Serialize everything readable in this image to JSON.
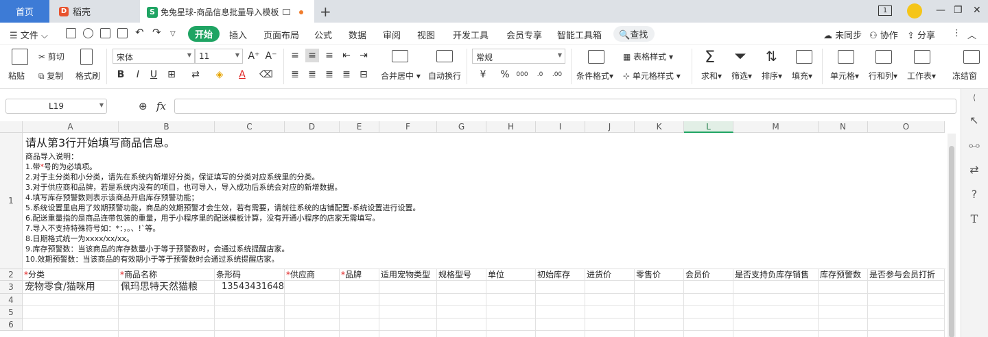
{
  "tabs": {
    "home": "首页",
    "docer": "稻壳",
    "file_title": "免兔星球-商品信息批量导入模板",
    "add": "+"
  },
  "window": {
    "page_indicator": "1",
    "minimize": "—",
    "restore": "❐",
    "close": "✕"
  },
  "menu": {
    "file": "文件",
    "items": [
      "开始",
      "插入",
      "页面布局",
      "公式",
      "数据",
      "审阅",
      "视图",
      "开发工具",
      "会员专享",
      "智能工具箱"
    ],
    "search": "查找",
    "right": [
      "未同步",
      "协作",
      "分享"
    ]
  },
  "ribbon": {
    "paste": "粘贴",
    "cut": "剪切",
    "copy": "复制",
    "format_painter": "格式刷",
    "font_name": "宋体",
    "font_size": "11",
    "merge_center": "合并居中",
    "wrap_text": "自动换行",
    "number_format": "常规",
    "conditional_format": "条件格式",
    "table_style": "表格样式",
    "cell_style": "单元格样式",
    "sum": "求和",
    "filter": "筛选",
    "sort": "排序",
    "fill": "填充",
    "cell": "单元格",
    "row_col": "行和列",
    "worksheet": "工作表",
    "freeze": "冻结窗"
  },
  "formula_bar": {
    "name_box": "L19",
    "fx": "fx",
    "value": ""
  },
  "columns": [
    "A",
    "B",
    "C",
    "D",
    "E",
    "F",
    "G",
    "H",
    "I",
    "J",
    "K",
    "L",
    "M",
    "N",
    "O"
  ],
  "selected_column": "L",
  "rows": [
    "1",
    "2",
    "3",
    "4",
    "5",
    "6"
  ],
  "instructions": {
    "title": "请从第3行开始填写商品信息。",
    "subtitle": "商品导入说明：",
    "line1_prefix": "1.带",
    "line1_star": "*",
    "line1_suffix": "号的为必填项。",
    "lines": [
      "2.对于主分类和小分类，请先在系统内新增好分类，保证填写的分类对应系统里的分类。",
      "3.对于供应商和品牌，若是系统内没有的项目，也可导入，导入成功后系统会对应的新增数据。",
      "4.填写库存预警数则表示该商品开启库存预警功能；",
      "5.系统设置里启用了效期预警功能，商品的效期预警才会生效，若有需要，请前往系统的店铺配置-系统设置进行设置。",
      "6.配送重量指的是商品连带包装的重量，用于小程序里的配送模板计算，没有开通小程序的店家无需填写。",
      "7.导入不支持特殊符号如：*：，。、!`等。",
      "8.日期格式统一为xxxx/xx/xx。",
      "9.库存预警数：当该商品的库存数量小于等于预警数时，会通过系统提醒店家。",
      "10.效期预警数：当该商品的有效期小于等于预警数时会通过系统提醒店家。"
    ]
  },
  "header_row": [
    {
      "req": true,
      "label": "分类"
    },
    {
      "req": true,
      "label": "商品名称"
    },
    {
      "req": false,
      "label": "条形码"
    },
    {
      "req": true,
      "label": "供应商"
    },
    {
      "req": true,
      "label": "品牌"
    },
    {
      "req": false,
      "label": "适用宠物类型"
    },
    {
      "req": false,
      "label": "规格型号"
    },
    {
      "req": false,
      "label": "单位"
    },
    {
      "req": false,
      "label": "初始库存"
    },
    {
      "req": false,
      "label": "进货价"
    },
    {
      "req": false,
      "label": "零售价"
    },
    {
      "req": false,
      "label": "会员价"
    },
    {
      "req": false,
      "label": "是否支持负库存销售"
    },
    {
      "req": false,
      "label": "库存预警数"
    },
    {
      "req": false,
      "label": "是否参与会员打折"
    }
  ],
  "row3": {
    "category": "宠物零食/猫咪用",
    "name": "佩玛思特天然猫粮",
    "barcode": "13543431648"
  }
}
